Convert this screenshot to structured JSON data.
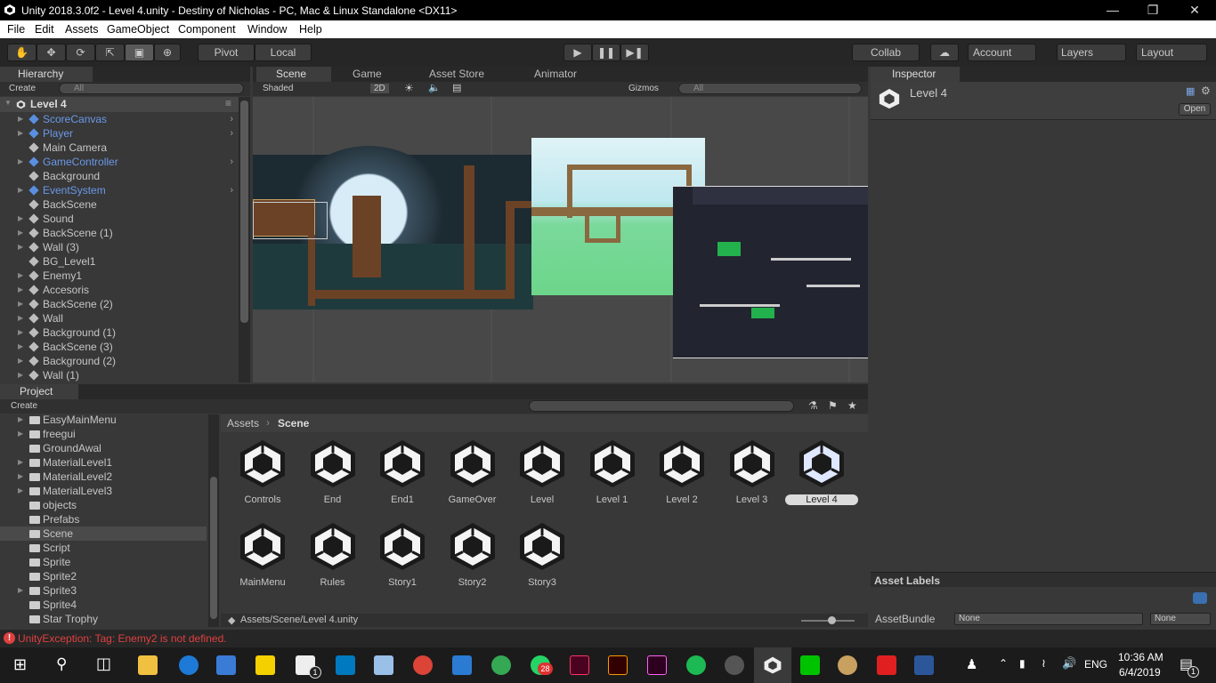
{
  "window": {
    "title": "Unity 2018.3.0f2 - Level 4.unity - Destiny of Nicholas - PC, Mac & Linux Standalone <DX11>"
  },
  "menu": [
    "File",
    "Edit",
    "Assets",
    "GameObject",
    "Component",
    "Window",
    "Help"
  ],
  "toolbar": {
    "pivot": "Pivot",
    "local": "Local",
    "collab": "Collab",
    "account": "Account",
    "layers": "Layers",
    "layout": "Layout"
  },
  "hierarchy": {
    "tab": "Hierarchy",
    "create": "Create",
    "search_placeholder": "All",
    "scene_name": "Level 4",
    "items": [
      {
        "label": "ScoreCanvas",
        "blue": true,
        "expandable": true,
        "arrow": true
      },
      {
        "label": "Player",
        "blue": true,
        "expandable": true,
        "arrow": true
      },
      {
        "label": "Main Camera",
        "blue": false,
        "expandable": false,
        "arrow": false
      },
      {
        "label": "GameController",
        "blue": true,
        "expandable": true,
        "arrow": true
      },
      {
        "label": "Background",
        "blue": false,
        "expandable": false,
        "arrow": false
      },
      {
        "label": "EventSystem",
        "blue": true,
        "expandable": true,
        "arrow": true
      },
      {
        "label": "BackScene",
        "blue": false,
        "expandable": false,
        "arrow": false
      },
      {
        "label": "Sound",
        "blue": false,
        "expandable": true,
        "arrow": false
      },
      {
        "label": "BackScene (1)",
        "blue": false,
        "expandable": true,
        "arrow": false
      },
      {
        "label": "Wall (3)",
        "blue": false,
        "expandable": true,
        "arrow": false
      },
      {
        "label": "BG_Level1",
        "blue": false,
        "expandable": false,
        "arrow": false
      },
      {
        "label": "Enemy1",
        "blue": false,
        "expandable": true,
        "arrow": false
      },
      {
        "label": "Accesoris",
        "blue": false,
        "expandable": true,
        "arrow": false
      },
      {
        "label": "BackScene (2)",
        "blue": false,
        "expandable": true,
        "arrow": false
      },
      {
        "label": "Wall",
        "blue": false,
        "expandable": true,
        "arrow": false
      },
      {
        "label": "Background (1)",
        "blue": false,
        "expandable": true,
        "arrow": false
      },
      {
        "label": "BackScene (3)",
        "blue": false,
        "expandable": true,
        "arrow": false
      },
      {
        "label": "Background (2)",
        "blue": false,
        "expandable": true,
        "arrow": false
      },
      {
        "label": "Wall (1)",
        "blue": false,
        "expandable": true,
        "arrow": false
      }
    ]
  },
  "scene": {
    "tabs": [
      "Scene",
      "Game",
      "Asset Store",
      "Animator"
    ],
    "shading": "Shaded",
    "mode_2d": "2D",
    "gizmos": "Gizmos",
    "search_placeholder": "All"
  },
  "inspector": {
    "tab": "Inspector",
    "asset_name": "Level 4",
    "open": "Open",
    "asset_labels": "Asset Labels",
    "asset_bundle": "AssetBundle",
    "bundle_value": "None",
    "variant_value": "None"
  },
  "project": {
    "tab": "Project",
    "create": "Create",
    "folders": [
      {
        "label": "EasyMainMenu",
        "expandable": true
      },
      {
        "label": "freegui",
        "expandable": true
      },
      {
        "label": "GroundAwal",
        "expandable": false
      },
      {
        "label": "MaterialLevel1",
        "expandable": true
      },
      {
        "label": "MaterialLevel2",
        "expandable": true
      },
      {
        "label": "MaterialLevel3",
        "expandable": true
      },
      {
        "label": "objects",
        "expandable": false
      },
      {
        "label": "Prefabs",
        "expandable": false
      },
      {
        "label": "Scene",
        "expandable": false,
        "selected": true
      },
      {
        "label": "Script",
        "expandable": false
      },
      {
        "label": "Sprite",
        "expandable": false
      },
      {
        "label": "Sprite2",
        "expandable": false
      },
      {
        "label": "Sprite3",
        "expandable": true
      },
      {
        "label": "Sprite4",
        "expandable": false
      },
      {
        "label": "Star Trophy",
        "expandable": false
      }
    ],
    "breadcrumb_root": "Assets",
    "breadcrumb_current": "Scene",
    "assets": [
      "Controls",
      "End",
      "End1",
      "GameOver",
      "Level",
      "Level 1",
      "Level 2",
      "Level 3",
      "Level 4",
      "MainMenu",
      "Rules",
      "Story1",
      "Story2",
      "Story3"
    ],
    "selected_asset": "Level 4",
    "path": "Assets/Scene/Level 4.unity"
  },
  "console": {
    "error": "UnityException: Tag: Enemy2 is not defined."
  },
  "taskbar": {
    "time": "10:36 AM",
    "date": "6/4/2019",
    "lang": "ENG",
    "whatsapp_badge": "28",
    "mail_badge": "1",
    "notif_badge": "1"
  },
  "colors": {
    "unity_dark": "#383838",
    "error_red": "#e04040",
    "selection_blue": "#6a98e8",
    "green_tile": "#22b14c"
  }
}
